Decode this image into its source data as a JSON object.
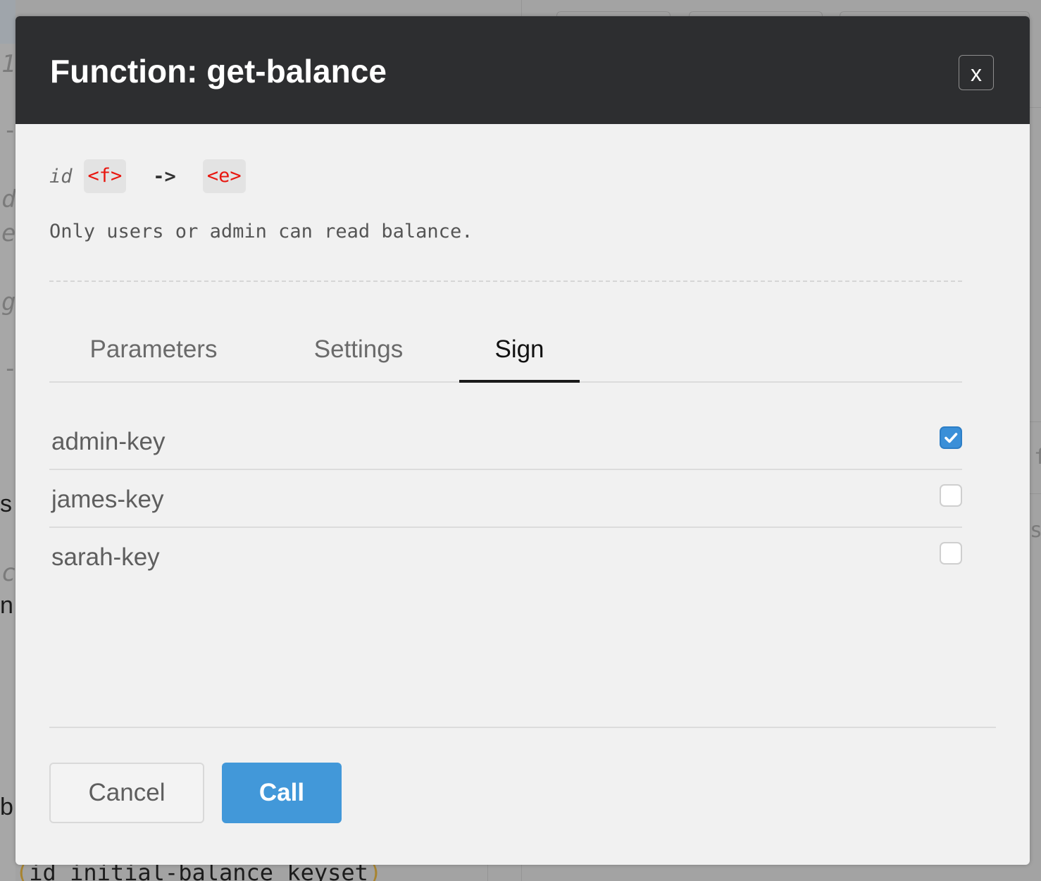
{
  "background": {
    "left_glyphs": [
      "1",
      "-",
      "d",
      "e",
      "g",
      "-",
      "s",
      "c",
      "n",
      "b"
    ],
    "right_glyphs": [
      "f",
      "si"
    ],
    "bottom_code": {
      "open_paren": "(",
      "text": "id initial-balance keyset",
      "close_paren": ")"
    }
  },
  "modal": {
    "title_prefix": "Function: ",
    "title_name": "get-balance",
    "close_label": "x",
    "signature": {
      "param": "id",
      "param_type": "<f>",
      "arrow": "->",
      "return_type": "<e>"
    },
    "description": "Only users or admin can read balance.",
    "tabs": [
      {
        "label": "Parameters",
        "active": false
      },
      {
        "label": "Settings",
        "active": false
      },
      {
        "label": "Sign",
        "active": true
      }
    ],
    "keys": [
      {
        "label": "admin-key",
        "checked": true
      },
      {
        "label": "james-key",
        "checked": false
      },
      {
        "label": "sarah-key",
        "checked": false
      }
    ],
    "buttons": {
      "cancel": "Cancel",
      "call": "Call"
    }
  },
  "colors": {
    "header_bg": "#2d2e30",
    "modal_bg": "#f1f1f1",
    "accent": "#4298d9",
    "type_red": "#e8160f"
  }
}
